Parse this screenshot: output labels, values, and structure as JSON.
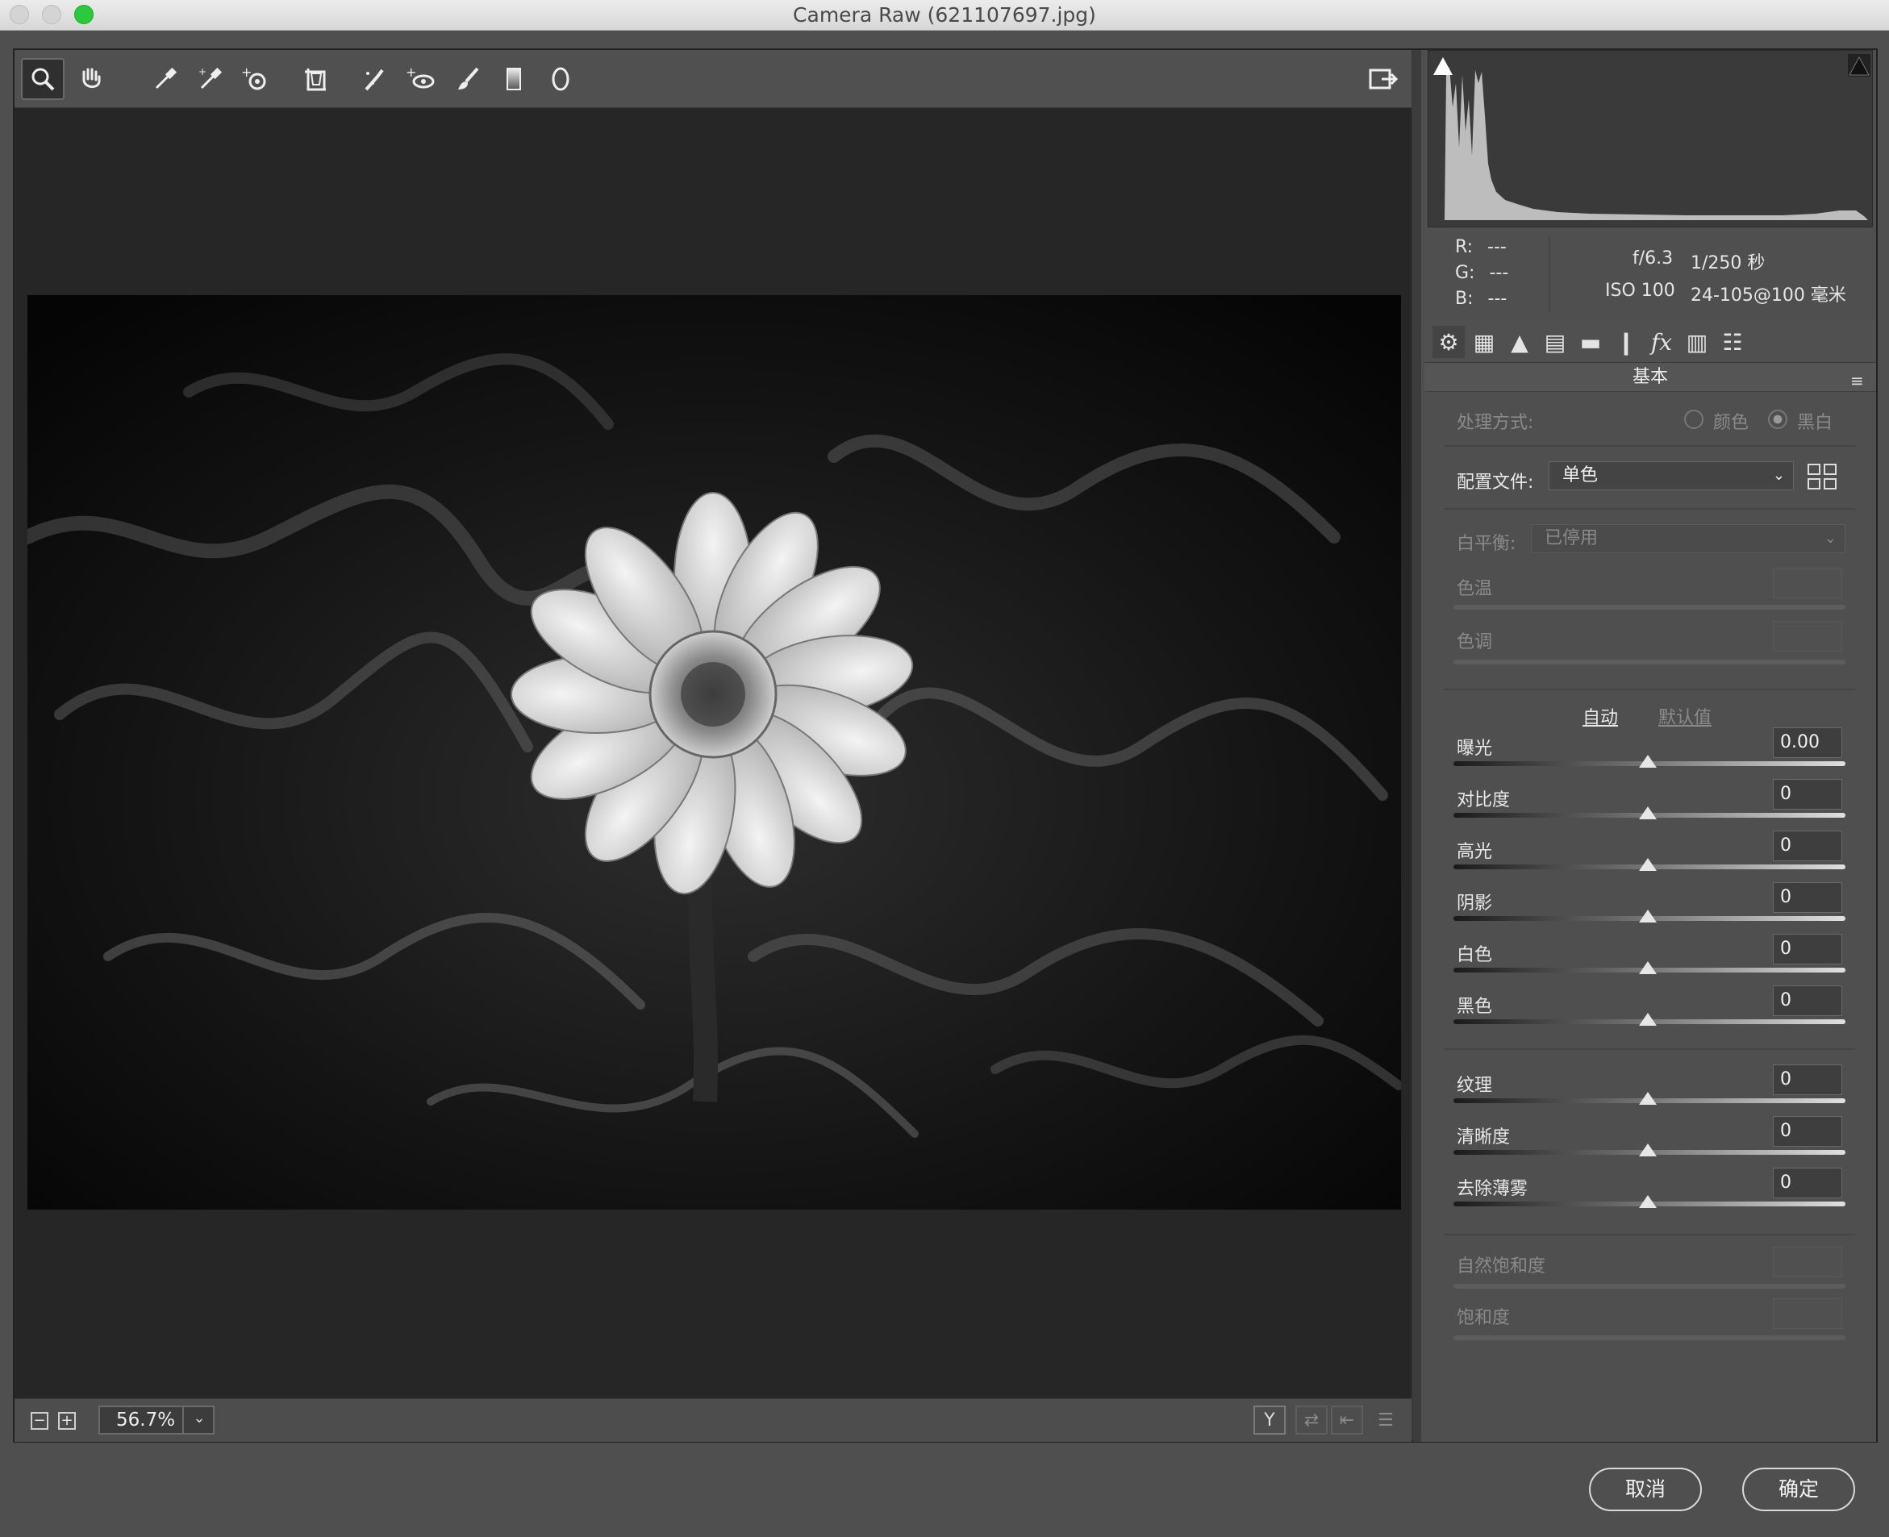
{
  "window": {
    "title": "Camera Raw (621107697.jpg)"
  },
  "toolbar": {
    "tools": [
      {
        "icon": "zoom-icon",
        "glyph": "🔍"
      },
      {
        "icon": "hand-icon",
        "glyph": "✋"
      },
      {
        "icon": "white-balance-eyedropper-icon",
        "glyph": "✒"
      },
      {
        "icon": "color-sampler-icon",
        "glyph": "✒"
      },
      {
        "icon": "targeted-adjustment-icon",
        "glyph": "⊙"
      },
      {
        "icon": "transform-icon",
        "glyph": "⌗"
      },
      {
        "icon": "spot-removal-icon",
        "glyph": "✎"
      },
      {
        "icon": "red-eye-icon",
        "glyph": "👁"
      },
      {
        "icon": "adjustment-brush-icon",
        "glyph": "🖌"
      },
      {
        "icon": "graduated-filter-icon",
        "glyph": "▮"
      },
      {
        "icon": "radial-filter-icon",
        "glyph": "○"
      }
    ],
    "fullscreen_icon": "open-external-icon"
  },
  "bottombar": {
    "zoom": "56.7%"
  },
  "histogram": {
    "clip_shadow_icon": "shadow-clipping-icon",
    "clip_highlight_icon": "highlight-clipping-icon"
  },
  "info": {
    "r_label": "R:",
    "r_value": "---",
    "g_label": "G:",
    "g_value": "---",
    "b_label": "B:",
    "b_value": "---",
    "aperture": "f/6.3",
    "shutter": "1/250 秒",
    "iso": "ISO 100",
    "lens": "24-105@100 毫米"
  },
  "panel": {
    "section_title": "基本",
    "treatment": {
      "label": "处理方式:",
      "color": "颜色",
      "bw": "黑白"
    },
    "profile": {
      "label": "配置文件:",
      "value": "单色"
    },
    "white_balance": {
      "label": "白平衡:",
      "value": "已停用"
    },
    "temp_label": "色温",
    "tint_label": "色调",
    "auto_link": "自动",
    "default_link": "默认值",
    "sliders": [
      {
        "label": "曝光",
        "value": "0.00"
      },
      {
        "label": "对比度",
        "value": "0"
      },
      {
        "label": "高光",
        "value": "0"
      },
      {
        "label": "阴影",
        "value": "0"
      },
      {
        "label": "白色",
        "value": "0"
      },
      {
        "label": "黑色",
        "value": "0"
      }
    ],
    "presence": [
      {
        "label": "纹理",
        "value": "0"
      },
      {
        "label": "清晰度",
        "value": "0"
      },
      {
        "label": "去除薄雾",
        "value": "0"
      }
    ],
    "vibrance_label": "自然饱和度",
    "saturation_label": "饱和度"
  },
  "buttons": {
    "cancel": "取消",
    "ok": "确定"
  },
  "colors": {
    "window_bg": "#4f4f4f",
    "canvas_bg": "#262626",
    "panel_bg": "#4f4f4f",
    "close": "#e0443e",
    "min": "#dea123",
    "max": "#1aab29"
  }
}
